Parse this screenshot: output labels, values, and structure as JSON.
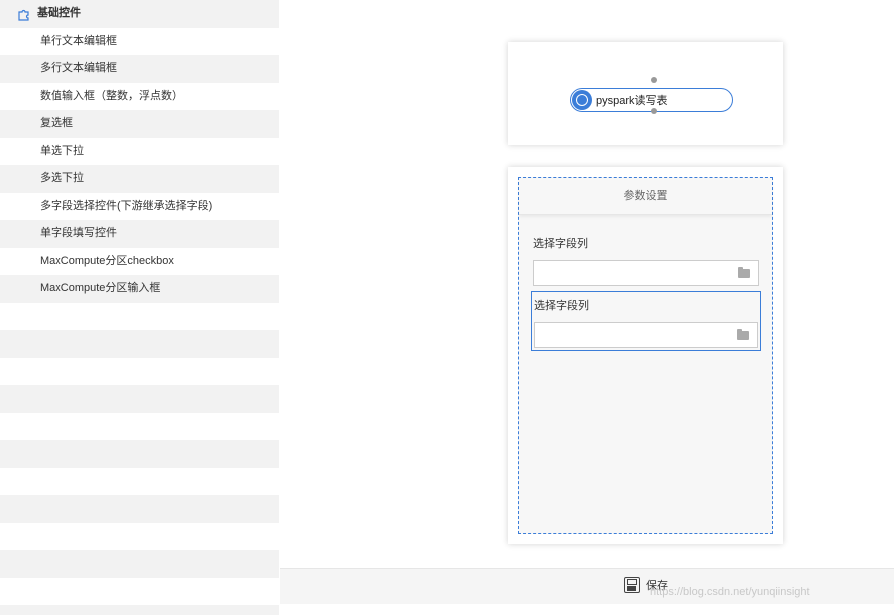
{
  "sidebar": {
    "group": {
      "label": "基础控件",
      "icon": "puzzle-icon"
    },
    "items": [
      {
        "label": "单行文本编辑框"
      },
      {
        "label": "多行文本编辑框"
      },
      {
        "label": "数值输入框（整数，浮点数）"
      },
      {
        "label": "复选框"
      },
      {
        "label": "单选下拉"
      },
      {
        "label": "多选下拉"
      },
      {
        "label": "多字段选择控件(下游继承选择字段)"
      },
      {
        "label": "单字段填写控件"
      },
      {
        "label": "MaxCompute分区checkbox"
      },
      {
        "label": "MaxCompute分区输入框"
      }
    ]
  },
  "canvas": {
    "node": {
      "label": "pyspark读写表",
      "icon": "node-circle-icon",
      "color": "#3b7dd8"
    }
  },
  "params": {
    "header": "参数设置",
    "fields": [
      {
        "label": "选择字段列",
        "value": "",
        "icon": "folder-icon"
      },
      {
        "label": "选择字段列",
        "value": "",
        "icon": "folder-icon"
      }
    ]
  },
  "footer": {
    "save_label": "保存",
    "save_icon": "floppy-disk-icon",
    "watermark": "https://blog.csdn.net/yunqiinsight"
  },
  "colors": {
    "accent": "#3b7dd8",
    "stripe": "#f2f2f2"
  }
}
